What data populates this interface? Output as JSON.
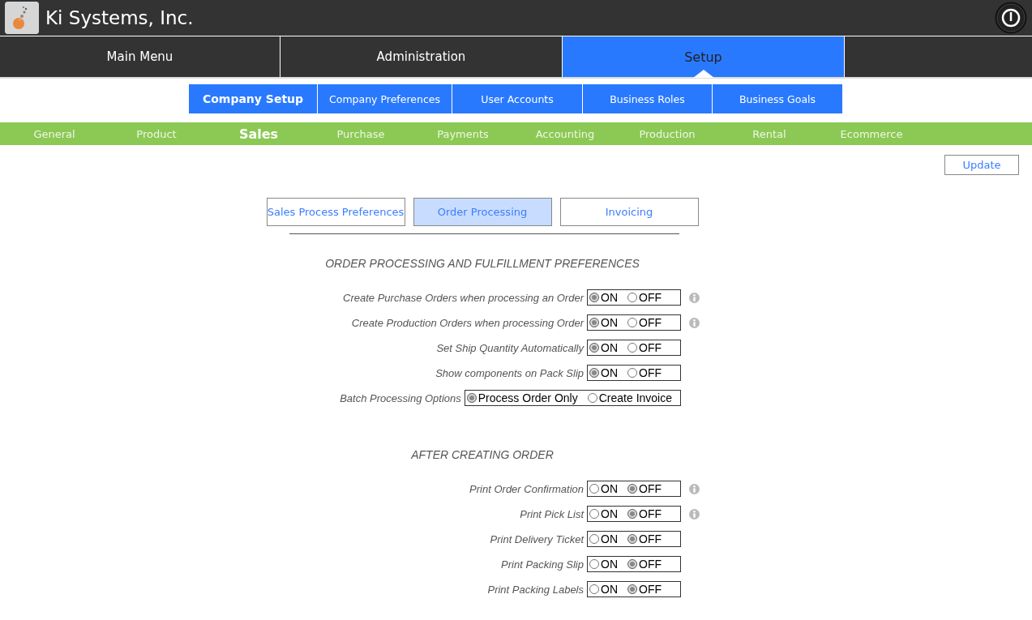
{
  "header": {
    "title": "Ki Systems, Inc."
  },
  "main_nav": [
    {
      "label": "Main Menu",
      "selected": false
    },
    {
      "label": "Administration",
      "selected": false
    },
    {
      "label": "Setup",
      "selected": true
    }
  ],
  "sub_nav": [
    {
      "label": "Company Setup",
      "selected": true
    },
    {
      "label": "Company Preferences",
      "selected": false
    },
    {
      "label": "User Accounts",
      "selected": false
    },
    {
      "label": "Business Roles",
      "selected": false
    },
    {
      "label": "Business Goals",
      "selected": false
    }
  ],
  "category_nav": [
    {
      "label": "General",
      "selected": false
    },
    {
      "label": "Product",
      "selected": false
    },
    {
      "label": "Sales",
      "selected": true
    },
    {
      "label": "Purchase",
      "selected": false
    },
    {
      "label": "Payments",
      "selected": false
    },
    {
      "label": "Accounting",
      "selected": false
    },
    {
      "label": "Production",
      "selected": false
    },
    {
      "label": "Rental",
      "selected": false
    },
    {
      "label": "Ecommerce",
      "selected": false
    }
  ],
  "update_button": "Update",
  "tabs": [
    {
      "label": "Sales Process Preferences",
      "selected": false
    },
    {
      "label": "Order Processing",
      "selected": true
    },
    {
      "label": "Invoicing",
      "selected": false
    }
  ],
  "sections": [
    {
      "title": "ORDER PROCESSING AND FULFILLMENT PREFERENCES",
      "rows": [
        {
          "label": "Create Purchase Orders when processing an Order",
          "info": true,
          "options": [
            {
              "label": "ON",
              "selected": true
            },
            {
              "label": "OFF",
              "selected": false
            }
          ]
        },
        {
          "label": "Create Production Orders when processing Order",
          "info": true,
          "options": [
            {
              "label": "ON",
              "selected": true
            },
            {
              "label": "OFF",
              "selected": false
            }
          ]
        },
        {
          "label": "Set Ship Quantity Automatically",
          "info": false,
          "options": [
            {
              "label": "ON",
              "selected": true
            },
            {
              "label": "OFF",
              "selected": false
            }
          ]
        },
        {
          "label": "Show components on Pack Slip",
          "info": false,
          "options": [
            {
              "label": "ON",
              "selected": true
            },
            {
              "label": "OFF",
              "selected": false
            }
          ]
        },
        {
          "label": "Batch Processing Options",
          "info": false,
          "options": [
            {
              "label": "Process Order Only",
              "selected": true
            },
            {
              "label": "Create Invoice",
              "selected": false
            }
          ]
        }
      ]
    },
    {
      "title": "AFTER CREATING ORDER",
      "rows": [
        {
          "label": "Print Order Confirmation",
          "info": true,
          "options": [
            {
              "label": "ON",
              "selected": false
            },
            {
              "label": "OFF",
              "selected": true
            }
          ]
        },
        {
          "label": "Print Pick List",
          "info": true,
          "options": [
            {
              "label": "ON",
              "selected": false
            },
            {
              "label": "OFF",
              "selected": true
            }
          ]
        },
        {
          "label": "Print Delivery Ticket",
          "info": false,
          "options": [
            {
              "label": "ON",
              "selected": false
            },
            {
              "label": "OFF",
              "selected": true
            }
          ]
        },
        {
          "label": "Print Packing Slip",
          "info": false,
          "options": [
            {
              "label": "ON",
              "selected": false
            },
            {
              "label": "OFF",
              "selected": true
            }
          ]
        },
        {
          "label": "Print Packing Labels",
          "info": false,
          "options": [
            {
              "label": "ON",
              "selected": false
            },
            {
              "label": "OFF",
              "selected": true
            }
          ]
        }
      ]
    }
  ]
}
